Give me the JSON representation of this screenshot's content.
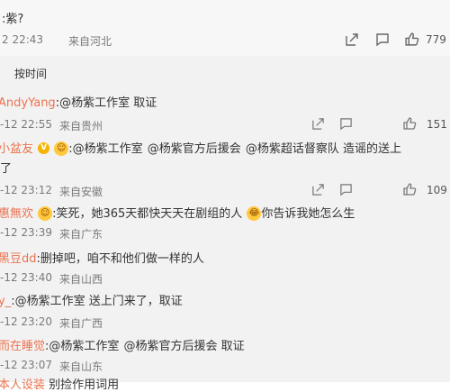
{
  "original": {
    "text_prefix": ":紫?",
    "time": "2 22:43",
    "location": "来自河北",
    "like_count": "779"
  },
  "sort_label": "按时间",
  "comments": [
    {
      "user": "AndyYang",
      "sep": ":",
      "mention1": "@杨紫工作室",
      "body": " 取证",
      "time": "-12 22:55",
      "location": "来自贵州",
      "like_count": "151"
    },
    {
      "user": "小盆友",
      "mention1": "@杨紫工作室",
      "mention2": "@杨紫官方后援会",
      "mention3": "@杨紫超话督察队",
      "body": " 造谣的送上",
      "body2": "了",
      "time": "-12 23:12",
      "location": "来自安徽",
      "like_count": "109"
    },
    {
      "user": "惠無欢",
      "body": ":笑死，她365天都快天天在剧组的人",
      "body_after": "你告诉我她怎么生",
      "time": "-12 23:39",
      "location": "来自广东"
    },
    {
      "user": "黑豆dd",
      "body": ":删掉吧，咱不和他们做一样的人",
      "time": "-12 23:40",
      "location": "来自山西"
    },
    {
      "user": "y_",
      "mention1": ":@杨紫工作室",
      "body": " 送上门来了，取证",
      "time": "-12 23:20",
      "location": "来自广西"
    },
    {
      "user": "而在睡觉",
      "mention1": ":@杨紫工作室",
      "mention2": "@杨紫官方后援会",
      "body": " 取证",
      "time": "-12 23:07",
      "location": "来自山东"
    },
    {
      "user": "本人设装",
      "body": " 别捡作用词用"
    }
  ],
  "colors": {
    "accent": "#eb7350",
    "meta": "#7a7a7a",
    "background": "#f2f2f2"
  },
  "icons": [
    "share-icon",
    "comment-icon",
    "like-icon",
    "smile-emoji-icon"
  ]
}
